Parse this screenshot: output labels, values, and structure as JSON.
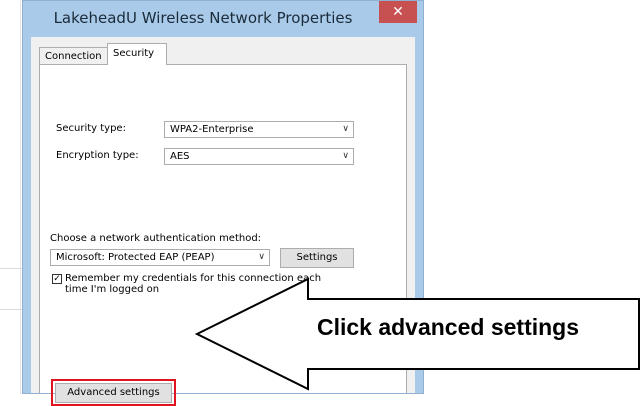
{
  "window": {
    "title": "LakeheadU Wireless Network Properties",
    "close_icon": "close-icon"
  },
  "tabs": [
    {
      "label": "Connection",
      "active": false
    },
    {
      "label": "Security",
      "active": true
    }
  ],
  "security": {
    "security_type_label": "Security type:",
    "security_type_value": "WPA2-Enterprise",
    "encryption_type_label": "Encryption type:",
    "encryption_type_value": "AES",
    "auth_method_label": "Choose a network authentication method:",
    "auth_method_value": "Microsoft: Protected EAP (PEAP)",
    "settings_button": "Settings",
    "remember_line1": "Remember my credentials for this connection each",
    "remember_line2": "time I'm logged on",
    "remember_checked": true,
    "advanced_button": "Advanced settings"
  },
  "annotation": {
    "callout_text": "Click advanced settings",
    "highlight_color": "#e0141e"
  },
  "colors": {
    "titlebar": "#a9cbe9",
    "close_button": "#c75050"
  }
}
